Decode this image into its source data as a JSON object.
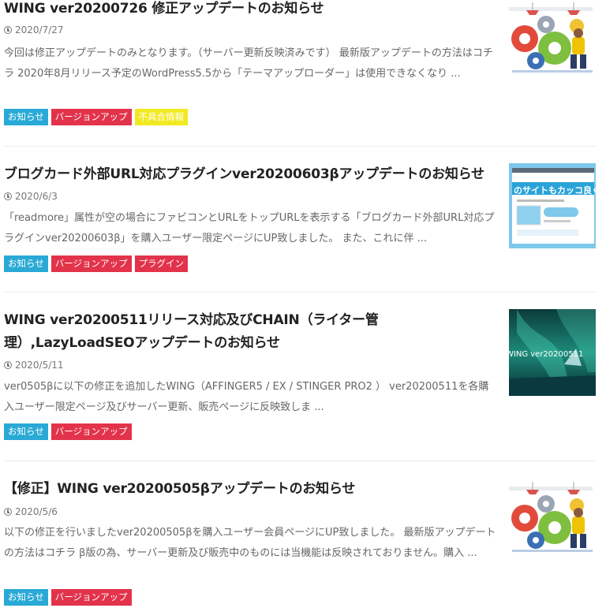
{
  "colors": {
    "tag_info": "#29a9d6",
    "tag_version": "#e2334b",
    "tag_bug": "#f1ea23",
    "tag_plugin": "#e2334b",
    "title": "#222222",
    "meta": "#777777"
  },
  "posts": [
    {
      "title": "WING ver20200726 修正アップデートのお知らせ",
      "date": "2020/7/27",
      "excerpt": "今回は修正アップデートのみとなります。（サーバー更新反映済みです） 最新版アップデートの方法はコチラ 2020年8月リリース予定のWordPress5.5から「テーマアップローダー」は使用できなくなり ...",
      "tags": [
        "お知らせ",
        "バージョンアップ",
        "不具合情報"
      ],
      "thumb_icon": "gears-illustration-icon"
    },
    {
      "title": "ブログカード外部URL対応プラグインver20200603βアップデートのお知らせ",
      "date": "2020/6/3",
      "excerpt": "「readmore」属性が空の場合にファビコンとURLをトップURLを表示する「ブログカード外部URL対応プラグインver20200603β」を購入ユーザー限定ページにUP致しました。 また、これに伴 ...",
      "tags": [
        "お知らせ",
        "バージョンアップ",
        "プラグイン"
      ],
      "thumb_text": "のサイトもカッコ良く。",
      "thumb_icon": "blogcard-screen-icon"
    },
    {
      "title": "WING ver20200511リリース対応及びCHAIN（ライター管理）,LazyLoadSEOアップデートのお知らせ",
      "date": "2020/5/11",
      "excerpt": "ver0505βに以下の修正を追加したWING（AFFINGER5 / EX / STINGER PRO2 ） ver20200511を各購入ユーザー限定ページ及びサーバー更新、販売ページに反映致しま ...",
      "tags": [
        "お知らせ",
        "バージョンアップ"
      ],
      "thumb_text": "WING ver20200511",
      "thumb_icon": "aurora-illustration-icon"
    },
    {
      "title": "【修正】WING ver20200505βアップデートのお知らせ",
      "date": "2020/5/6",
      "excerpt": "以下の修正を行いましたver20200505βを購入ユーザー会員ページにUP致しました。 最新版アップデートの方法はコチラ β版の為、サーバー更新及び販売中のものには当機能は反映されておりません。購入 ...",
      "tags": [
        "お知らせ",
        "バージョンアップ"
      ],
      "thumb_icon": "gears-illustration-icon"
    }
  ]
}
